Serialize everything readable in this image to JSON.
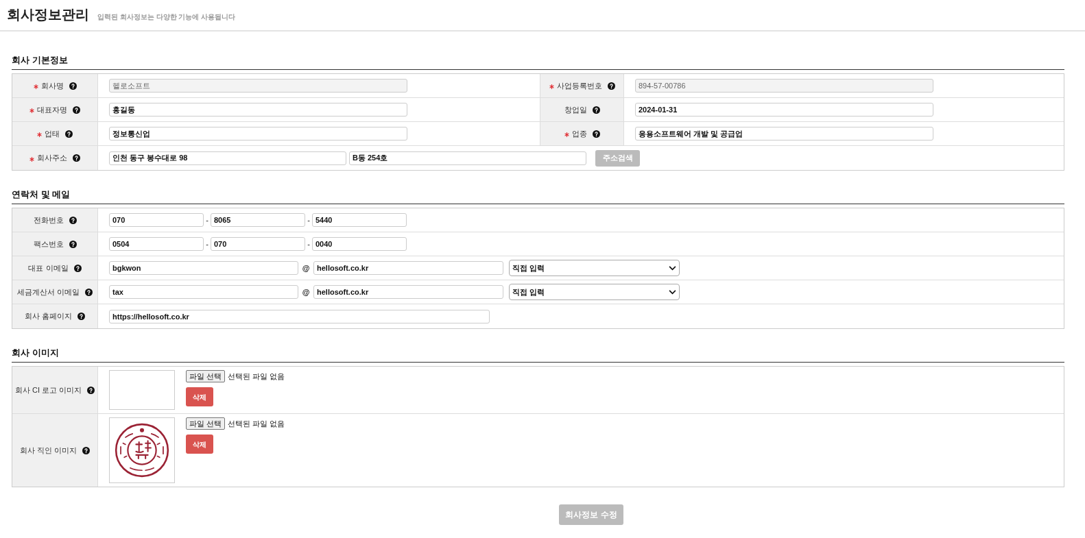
{
  "header": {
    "title": "회사정보관리",
    "subtitle": "입력된 회사정보는 다양한 기능에 사용됩니다"
  },
  "sections": [
    {
      "title": "회사 기본정보",
      "rows": [
        {
          "cells": [
            {
              "label": "회사명",
              "required": true,
              "kind": "text",
              "value": "헬로소프트",
              "disabled": true
            },
            {
              "label": "사업등록번호",
              "required": true,
              "kind": "text",
              "value": "894-57-00786",
              "disabled": true
            }
          ]
        },
        {
          "cells": [
            {
              "label": "대표자명",
              "required": true,
              "kind": "text",
              "value": "홍길동",
              "disabled": false
            },
            {
              "label": "창업일",
              "required": false,
              "kind": "text",
              "value": "2024-01-31",
              "disabled": false
            }
          ]
        },
        {
          "cells": [
            {
              "label": "업태",
              "required": true,
              "kind": "text",
              "value": "정보통신업",
              "disabled": false
            },
            {
              "label": "업종",
              "required": true,
              "kind": "text",
              "value": "응용소프트웨어 개발 및 공급업",
              "disabled": false
            }
          ]
        },
        {
          "cells": [
            {
              "label": "회사주소",
              "required": true,
              "kind": "address",
              "values": [
                "인천 동구 봉수대로 98",
                "B동 254호"
              ],
              "button": "주소검색"
            }
          ]
        }
      ]
    },
    {
      "title": "연락처 및 메일",
      "rows": [
        {
          "cells": [
            {
              "label": "전화번호",
              "required": false,
              "kind": "phone",
              "values": [
                "070",
                "8065",
                "5440"
              ],
              "separators": [
                "-",
                "-"
              ]
            }
          ]
        },
        {
          "cells": [
            {
              "label": "팩스번호",
              "required": false,
              "kind": "phone",
              "values": [
                "0504",
                "070",
                "0040"
              ],
              "separators": [
                "-",
                "-"
              ]
            }
          ]
        },
        {
          "cells": [
            {
              "label": "대표 이메일",
              "required": false,
              "kind": "email",
              "local": "bgkwon",
              "at": "@",
              "domain": "hellosoft.co.kr",
              "select": "직접 입력"
            }
          ]
        },
        {
          "cells": [
            {
              "label": "세금계산서 이메일",
              "required": false,
              "kind": "email",
              "local": "tax",
              "at": "@",
              "domain": "hellosoft.co.kr",
              "select": "직접 입력"
            }
          ]
        },
        {
          "cells": [
            {
              "label": "회사 홈페이지",
              "required": false,
              "kind": "url",
              "value": "https://hellosoft.co.kr",
              "disabled": false
            }
          ]
        }
      ]
    },
    {
      "title": "회사 이미지",
      "rows": [
        {
          "cells": [
            {
              "label": "회사 CI 로고 이미지",
              "required": false,
              "kind": "logo_image",
              "file_button": "파일 선택",
              "file_status": "선택된 파일 없음",
              "delete_button": "삭제"
            }
          ]
        },
        {
          "cells": [
            {
              "label": "회사 직인 이미지",
              "required": false,
              "kind": "seal_image",
              "file_button": "파일 선택",
              "file_status": "선택된 파일 없음",
              "delete_button": "삭제"
            }
          ]
        }
      ]
    }
  ],
  "submit_button": "회사정보 수정"
}
